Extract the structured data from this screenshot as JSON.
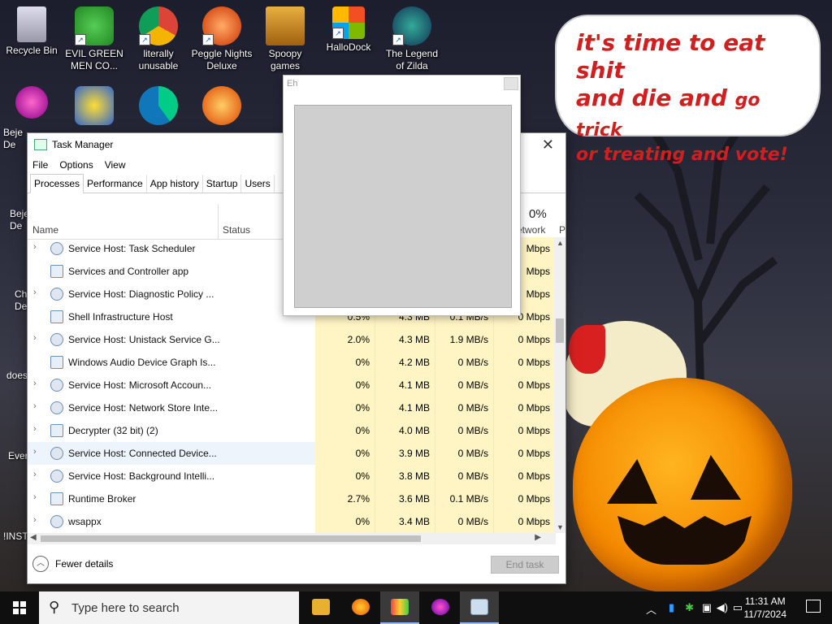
{
  "desktop": {
    "icons_row1": [
      {
        "label": "Recycle Bin"
      },
      {
        "label": "EVIL GREEN MEN CO..."
      },
      {
        "label": "literally unusable"
      },
      {
        "label": "Peggle Nights Deluxe"
      },
      {
        "label": "Spoopy games"
      },
      {
        "label": "HalloDock"
      },
      {
        "label": "The Legend of Zilda"
      }
    ],
    "left_partial_labels": [
      "Beje",
      "De",
      "Beje",
      "De",
      "Ch",
      "De",
      "does",
      "Ever",
      "!INST"
    ],
    "wallpaper_text": {
      "line1": "it's time to eat shit",
      "line2a": "and die and",
      "line2b": "go trick",
      "line3": "or treating and vote!"
    }
  },
  "task_manager": {
    "title": "Task Manager",
    "menu": [
      "File",
      "Options",
      "View"
    ],
    "tabs": [
      "Processes",
      "Performance",
      "App history",
      "Startup",
      "Users"
    ],
    "headers": {
      "name": "Name",
      "status": "Status",
      "network_pct": "0%",
      "network": "etwork"
    },
    "processes": [
      {
        "name": "Service Host: Task Scheduler",
        "expandable": true,
        "icon": "gear-icon",
        "cpu": "",
        "mem": "",
        "disk": "",
        "net": "Mbps"
      },
      {
        "name": "Services and Controller app",
        "expandable": false,
        "icon": "window-icon",
        "cpu": "",
        "mem": "",
        "disk": "",
        "net": "Mbps"
      },
      {
        "name": "Service Host: Diagnostic Policy ...",
        "expandable": true,
        "icon": "gear-icon",
        "cpu": "",
        "mem": "",
        "disk": "",
        "net": "Mbps"
      },
      {
        "name": "Shell Infrastructure Host",
        "expandable": false,
        "icon": "window-icon",
        "cpu": "0.5%",
        "mem": "4.3 MB",
        "disk": "0.1 MB/s",
        "net": "0 Mbps"
      },
      {
        "name": "Service Host: Unistack Service G...",
        "expandable": true,
        "icon": "gear-icon",
        "cpu": "2.0%",
        "mem": "4.3 MB",
        "disk": "1.9 MB/s",
        "net": "0 Mbps"
      },
      {
        "name": "Windows Audio Device Graph Is...",
        "expandable": false,
        "icon": "window-icon",
        "cpu": "0%",
        "mem": "4.2 MB",
        "disk": "0 MB/s",
        "net": "0 Mbps"
      },
      {
        "name": "Service Host: Microsoft Accoun...",
        "expandable": true,
        "icon": "gear-icon",
        "cpu": "0%",
        "mem": "4.1 MB",
        "disk": "0 MB/s",
        "net": "0 Mbps"
      },
      {
        "name": "Service Host: Network Store Inte...",
        "expandable": true,
        "icon": "gear-icon",
        "cpu": "0%",
        "mem": "4.1 MB",
        "disk": "0 MB/s",
        "net": "0 Mbps"
      },
      {
        "name": "Decrypter (32 bit) (2)",
        "expandable": true,
        "icon": "window-icon",
        "cpu": "0%",
        "mem": "4.0 MB",
        "disk": "0 MB/s",
        "net": "0 Mbps"
      },
      {
        "name": "Service Host: Connected Device...",
        "expandable": true,
        "icon": "gear-icon",
        "cpu": "0%",
        "mem": "3.9 MB",
        "disk": "0 MB/s",
        "net": "0 Mbps",
        "highlighted": true
      },
      {
        "name": "Service Host: Background Intelli...",
        "expandable": true,
        "icon": "gear-icon",
        "cpu": "0%",
        "mem": "3.8 MB",
        "disk": "0 MB/s",
        "net": "0 Mbps"
      },
      {
        "name": "Runtime Broker",
        "expandable": true,
        "icon": "window-icon",
        "cpu": "2.7%",
        "mem": "3.6 MB",
        "disk": "0.1 MB/s",
        "net": "0 Mbps"
      },
      {
        "name": "wsappx",
        "expandable": true,
        "icon": "gear-icon",
        "cpu": "0%",
        "mem": "3.4 MB",
        "disk": "0 MB/s",
        "net": "0 Mbps"
      }
    ],
    "fewer_details": "Fewer details",
    "end_task": "End task"
  },
  "popup": {
    "title": "Eh",
    "image_note": ""
  },
  "taskbar": {
    "search_placeholder": "Type here to search",
    "time": "11:31 AM",
    "date": "11/7/2024"
  },
  "colors": {
    "cpu_col_bg": "#fff4c4",
    "cpu_sep": "#f0b400",
    "speech_text": "#d21e1e",
    "taskbar_bg": "#0f0f0f"
  }
}
